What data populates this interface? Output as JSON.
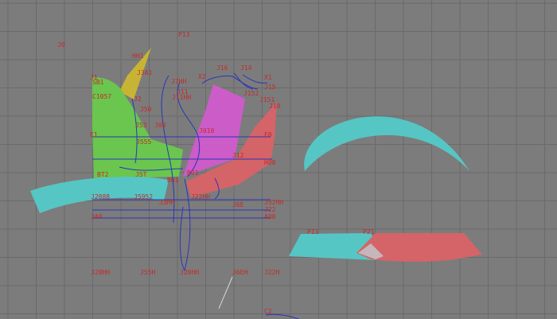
{
  "colors": {
    "background": "#7c7c7c",
    "grid": "#6a6a6a",
    "label": "#c42a2a",
    "curve": "#2b35b8",
    "cyan": "#56c6c4",
    "green": "#6ac64e",
    "yellow": "#c8b434",
    "magenta": "#cc5cc8",
    "red": "#d46468",
    "leader_line": "#d8d8d8"
  },
  "labels": {
    "j0": "J0",
    "p13": "P13",
    "hh1": "HH1",
    "j1": "J1",
    "sb1": "SB1",
    "c1057": "C1057",
    "j2": "J2",
    "j50": "J50",
    "j_cluster_top": "J3A1",
    "j7hh": "J7HH",
    "j11": "J11",
    "j11hh": "J11HH",
    "x2": "X2",
    "j16": "J16",
    "j14": "J14",
    "x1": "X1",
    "j15": "J15",
    "j152": "J152",
    "j151": "J151",
    "j10": "J10",
    "j53": "J53",
    "j08": "J08",
    "j010": "J010",
    "e1": "E1",
    "j555": "J555",
    "f0": "F0",
    "j12": "J12",
    "h00": "H00",
    "bt2": "BT2",
    "j5t": "J5T",
    "b01": "B01",
    "bu1": "BU1",
    "j2888": "J2888",
    "j5952": "J5952",
    "j3hh": "J3HH",
    "j22hh": "J22HH",
    "j52hh": "J52HH",
    "j6e": "J6E",
    "j22": "J22",
    "ja0": "JA0",
    "a00": "A00",
    "p11": "P11",
    "p21": "P21",
    "j20hh": "J20HH",
    "j55h": "J55H",
    "j20hh2": "J20HH",
    "j6eh": "J6EH",
    "j22h": "J22H",
    "c2": "C2"
  }
}
